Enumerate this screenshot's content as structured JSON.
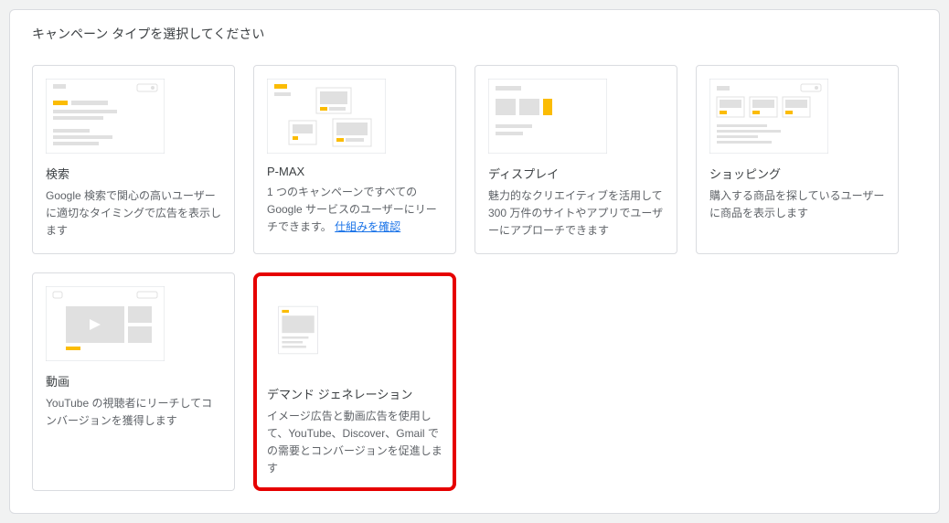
{
  "header": {
    "title": "キャンペーン タイプを選択してください"
  },
  "cards": [
    {
      "id": "search",
      "title": "検索",
      "desc": "Google 検索で関心の高いユーザーに適切なタイミングで広告を表示します",
      "highlight": false
    },
    {
      "id": "pmax",
      "title": "P-MAX",
      "desc_prefix": "1 つのキャンペーンですべての Google サービスのユーザーにリーチできます。",
      "link_text": "仕組みを確認",
      "highlight": false
    },
    {
      "id": "display",
      "title": "ディスプレイ",
      "desc": "魅力的なクリエイティブを活用して 300 万件のサイトやアプリでユーザーにアプローチできます",
      "highlight": false
    },
    {
      "id": "shopping",
      "title": "ショッピング",
      "desc": "購入する商品を探しているユーザーに商品を表示します",
      "highlight": false
    },
    {
      "id": "video",
      "title": "動画",
      "desc": "YouTube の視聴者にリーチしてコンバージョンを獲得します",
      "highlight": false
    },
    {
      "id": "demandgen",
      "title": "デマンド ジェネレーション",
      "desc": "イメージ広告と動画広告を使用して、YouTube、Discover、Gmail での需要とコンバージョンを促進します",
      "highlight": true
    }
  ]
}
